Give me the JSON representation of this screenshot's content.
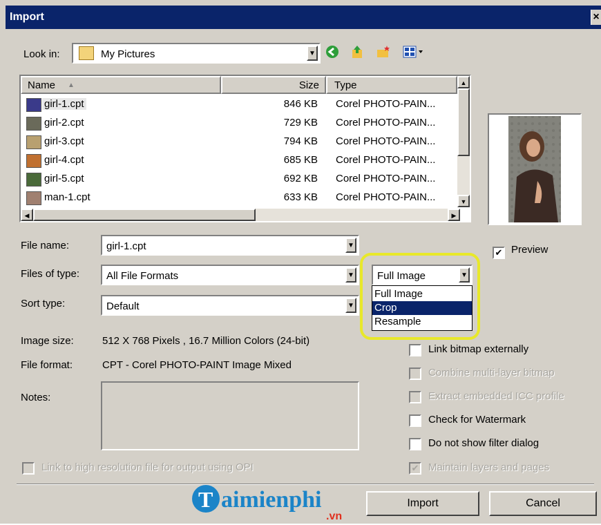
{
  "dialog": {
    "title": "Import",
    "close_glyph": "×"
  },
  "look_in": {
    "label": "Look in:",
    "value": "My Pictures"
  },
  "toolbar": {
    "back_icon": "back-icon",
    "up_icon": "up-folder-icon",
    "new_folder_icon": "new-folder-icon",
    "views_icon": "views-menu-icon"
  },
  "files": {
    "headers": {
      "name": "Name",
      "size": "Size",
      "type": "Type"
    },
    "rows": [
      {
        "name": "girl-1.cpt",
        "size": "846 KB",
        "type": "Corel PHOTO-PAIN..."
      },
      {
        "name": "girl-2.cpt",
        "size": "729 KB",
        "type": "Corel PHOTO-PAIN..."
      },
      {
        "name": "girl-3.cpt",
        "size": "794 KB",
        "type": "Corel PHOTO-PAIN..."
      },
      {
        "name": "girl-4.cpt",
        "size": "685 KB",
        "type": "Corel PHOTO-PAIN..."
      },
      {
        "name": "girl-5.cpt",
        "size": "692 KB",
        "type": "Corel PHOTO-PAIN..."
      },
      {
        "name": "man-1.cpt",
        "size": "633 KB",
        "type": "Corel PHOTO-PAIN..."
      }
    ],
    "selected": "girl-1.cpt"
  },
  "form": {
    "file_name_label": "File name:",
    "file_name": "girl-1.cpt",
    "files_of_type_label": "Files of type:",
    "files_of_type": "All File Formats",
    "sort_type_label": "Sort type:",
    "sort_type": "Default",
    "image_size_label": "Image size:",
    "image_size": "512 X 768 Pixels , 16.7 Million Colors (24-bit)",
    "file_format_label": "File format:",
    "file_format": "CPT - Corel PHOTO-PAINT Image Mixed",
    "notes_label": "Notes:"
  },
  "import_mode": {
    "selected": "Full Image",
    "options": [
      "Full Image",
      "Crop",
      "Resample"
    ],
    "highlighted": "Crop"
  },
  "preview": {
    "label": "Preview",
    "checked": true
  },
  "options": {
    "link_bitmap": "Link bitmap externally",
    "combine_layers": "Combine multi-layer bitmap",
    "extract_icc": "Extract embedded ICC profile",
    "check_watermark": "Check for Watermark",
    "no_filter_dialog": "Do not show filter dialog",
    "maintain_layers": "Maintain layers and pages",
    "link_opi": "Link to high resolution file for output using OPI"
  },
  "buttons": {
    "import": "Import",
    "cancel": "Cancel"
  },
  "watermark": {
    "brand": "aimienphi",
    "initial": "T",
    "tld": ".vn"
  }
}
